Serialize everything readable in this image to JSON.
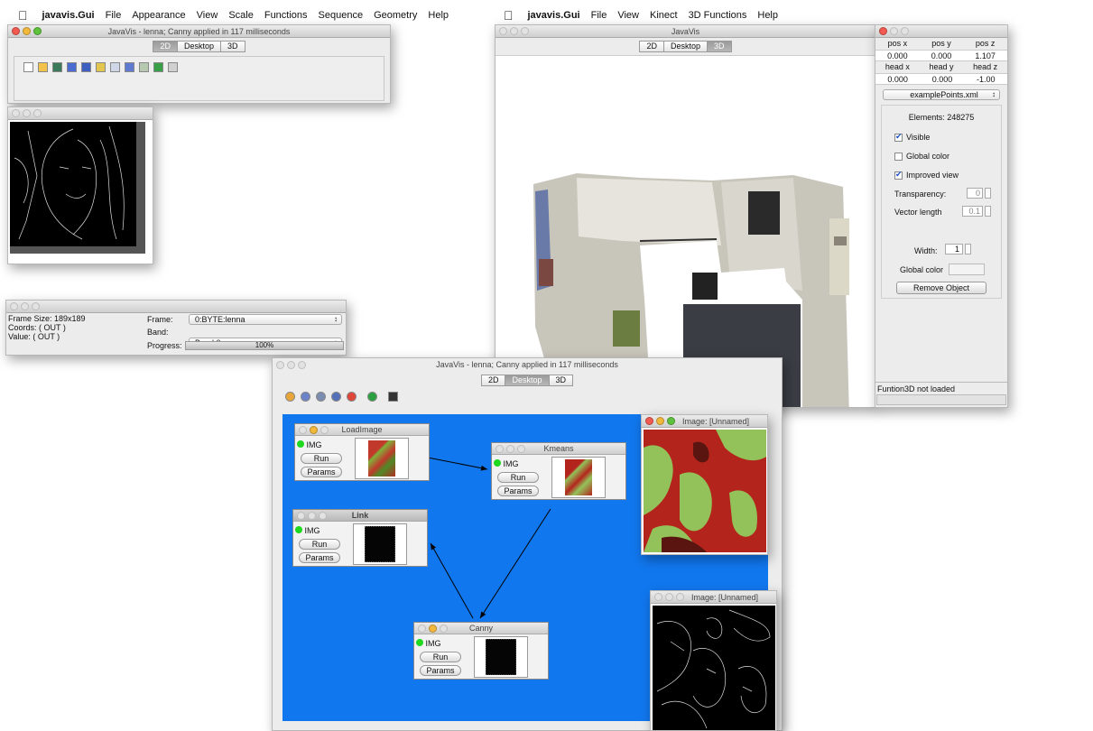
{
  "menubar_left": {
    "apple": "",
    "app": "javavis.Gui",
    "items": [
      "File",
      "Appearance",
      "View",
      "Scale",
      "Functions",
      "Sequence",
      "Geometry",
      "Help"
    ]
  },
  "menubar_right": {
    "apple": "",
    "app": "javavis.Gui",
    "items": [
      "File",
      "View",
      "Kinect",
      "3D Functions",
      "Help"
    ]
  },
  "main_window": {
    "title": "JavaVis - lenna; Canny applied in 117 milliseconds",
    "tabs": [
      "2D",
      "Desktop",
      "3D"
    ],
    "active_tab": "2D"
  },
  "frame_window": {
    "frame_size": "Frame Size: 189x189",
    "coords": "Coords: ( OUT )",
    "value": "Value: ( OUT )",
    "frame_label": "Frame:",
    "frame_value": "0:BYTE:lenna",
    "band_label": "Band:",
    "band_value": "Band 0",
    "progress_label": "Progress:",
    "progress_text": "100%",
    "progress": 1.0
  },
  "window_3d": {
    "title": "JavaVis",
    "tabs": [
      "2D",
      "Desktop",
      "3D"
    ],
    "active_tab": "3D"
  },
  "panel_3d": {
    "headers1": [
      "pos x",
      "pos y",
      "pos z"
    ],
    "values1": [
      "0.000",
      "0.000",
      "1.107"
    ],
    "headers2": [
      "head x",
      "head y",
      "head z"
    ],
    "values2": [
      "0.000",
      "0.000",
      "-1.00"
    ],
    "file": "examplePoints.xml",
    "elements": "Elements: 248275",
    "visible": "Visible",
    "global_color": "Global color",
    "improved_view": "Improved view",
    "transparency_label": "Transparency:",
    "transparency_value": "0",
    "vector_label": "Vector length",
    "vector_value": "0.1",
    "width_label": "Width:",
    "width_value": "1",
    "global_color2": "Global color",
    "remove": "Remove Object",
    "status": "Funtion3D not loaded"
  },
  "desktop_window": {
    "title": "JavaVis - lenna; Canny applied in 117 milliseconds",
    "tabs": [
      "2D",
      "Desktop",
      "3D"
    ],
    "active_tab": "Desktop"
  },
  "nodes": [
    {
      "title": "LoadImage",
      "port": "IMG",
      "run": "Run",
      "params": "Params"
    },
    {
      "title": "Kmeans",
      "port": "IMG",
      "run": "Run",
      "params": "Params"
    },
    {
      "title": "Link",
      "port": "IMG",
      "run": "Run",
      "params": "Params"
    },
    {
      "title": "Canny",
      "port": "IMG",
      "run": "Run",
      "params": "Params"
    }
  ],
  "image_win_1": {
    "title": "Image: [Unnamed]"
  },
  "image_win_2": {
    "title": "Image: [Unnamed]"
  },
  "colors": {
    "desktop_blue": "#1177ee",
    "accent": "#1b4fc9"
  }
}
